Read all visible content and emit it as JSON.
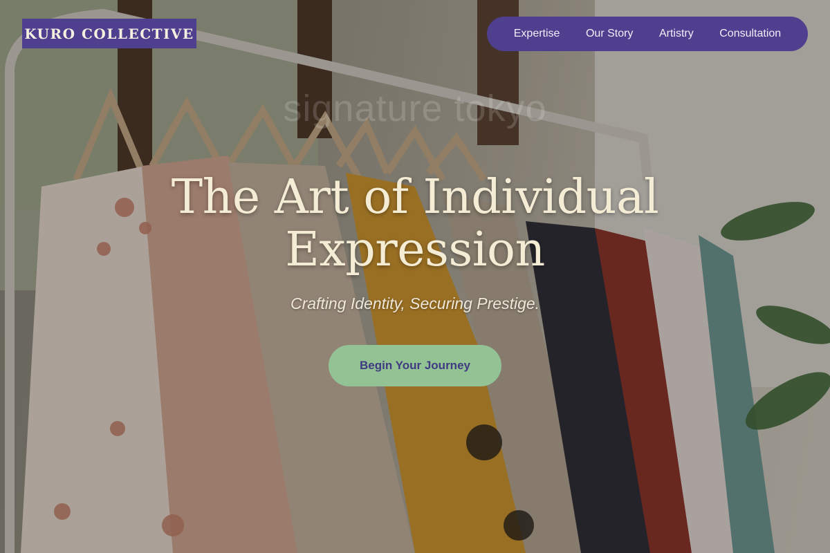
{
  "brand": {
    "logo_text": "KURO COLLECTIVE",
    "color": "#4f3f8f"
  },
  "nav": {
    "items": [
      {
        "label": "Expertise"
      },
      {
        "label": "Our Story"
      },
      {
        "label": "Artistry"
      },
      {
        "label": "Consultation"
      }
    ]
  },
  "hero": {
    "title_line1": "The Art of Individual",
    "title_line2": "Expression",
    "watermark": "signature tokyo",
    "tagline": "Crafting Identity, Securing Prestige.",
    "cta_label": "Begin Your Journey",
    "cta_color": "#93c295",
    "background_image": "clothing-rack-photo"
  }
}
